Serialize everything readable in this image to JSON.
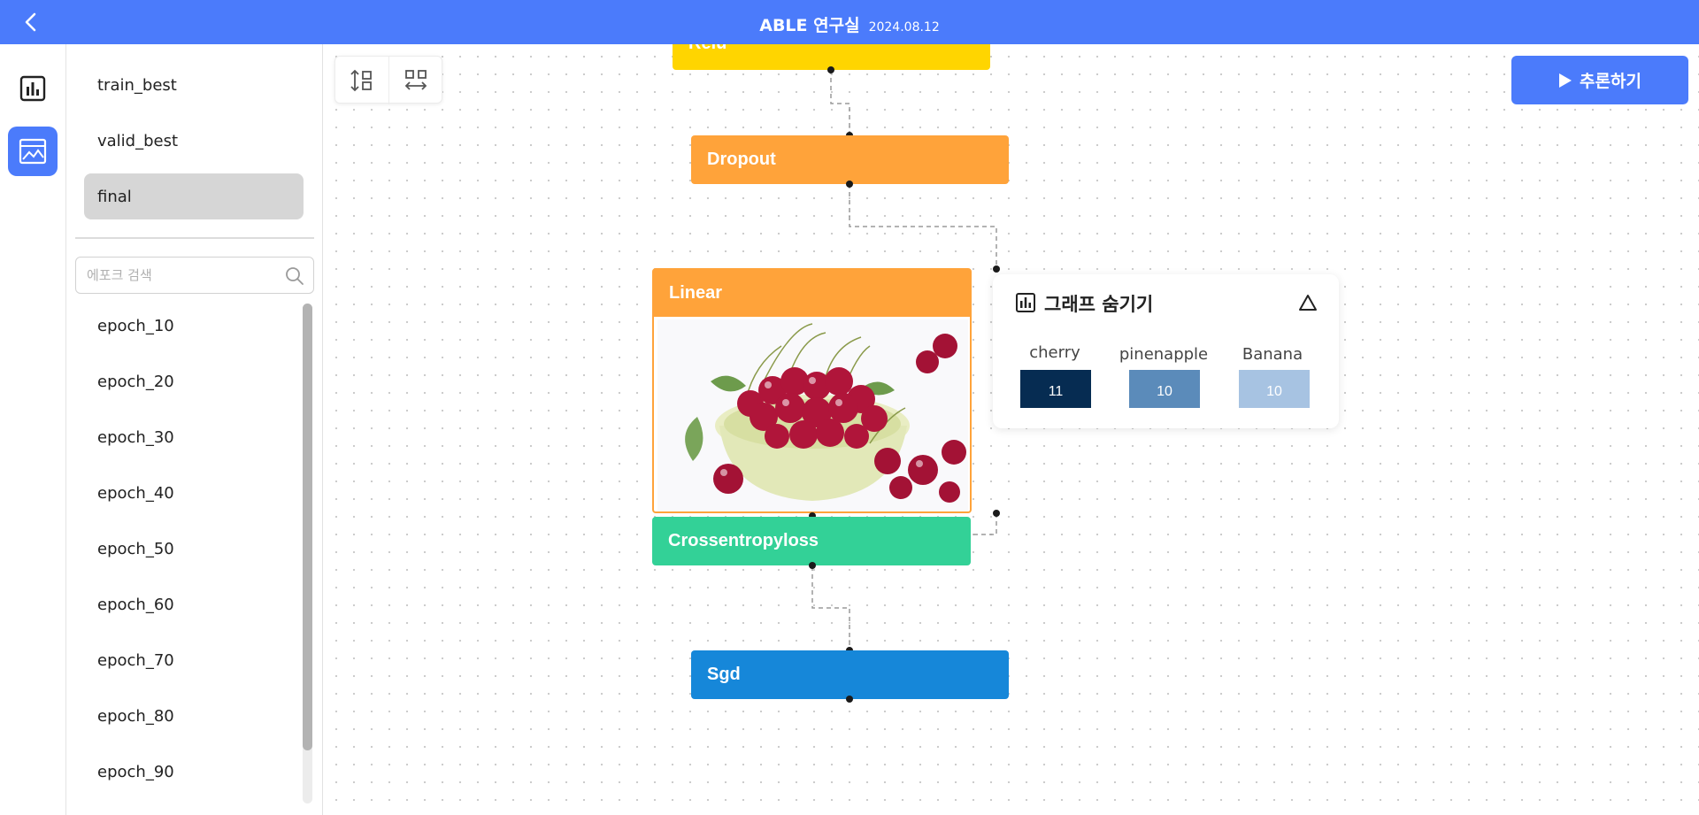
{
  "header": {
    "title": "ABLE 연구실",
    "date": "2024.08.12"
  },
  "sidebar": {
    "models": [
      {
        "label": "train_best",
        "selected": false
      },
      {
        "label": "valid_best",
        "selected": false
      },
      {
        "label": "final",
        "selected": true
      }
    ],
    "search": {
      "placeholder": "에포크 검색",
      "value": ""
    },
    "epochs": [
      "epoch_10",
      "epoch_20",
      "epoch_30",
      "epoch_40",
      "epoch_50",
      "epoch_60",
      "epoch_70",
      "epoch_80",
      "epoch_90"
    ]
  },
  "toolbar": {
    "vertical_layout_icon": "vertical-layout-icon",
    "horizontal_layout_icon": "horizontal-layout-icon"
  },
  "infer_button": {
    "label": "추론하기"
  },
  "nodes": {
    "relu": {
      "label": "Relu",
      "color": "#ffd500"
    },
    "dropout": {
      "label": "Dropout",
      "color": "#ffa33a"
    },
    "linear": {
      "label": "Linear",
      "color": "#ffa33a",
      "image": "cherries-in-bowl"
    },
    "crossentropy": {
      "label": "Crossentropyloss",
      "color": "#33d197"
    },
    "sgd": {
      "label": "Sgd",
      "color": "#1687d9"
    }
  },
  "result_panel": {
    "title": "그래프 숨기기",
    "results": [
      {
        "label": "cherry",
        "value": "11",
        "color": "#062c52"
      },
      {
        "label": "pinenapple",
        "value": "10",
        "color": "#5b8bba"
      },
      {
        "label": "Banana",
        "value": "10",
        "color": "#a7c3e2"
      }
    ]
  },
  "colors": {
    "accent": "#4b7bfb"
  }
}
